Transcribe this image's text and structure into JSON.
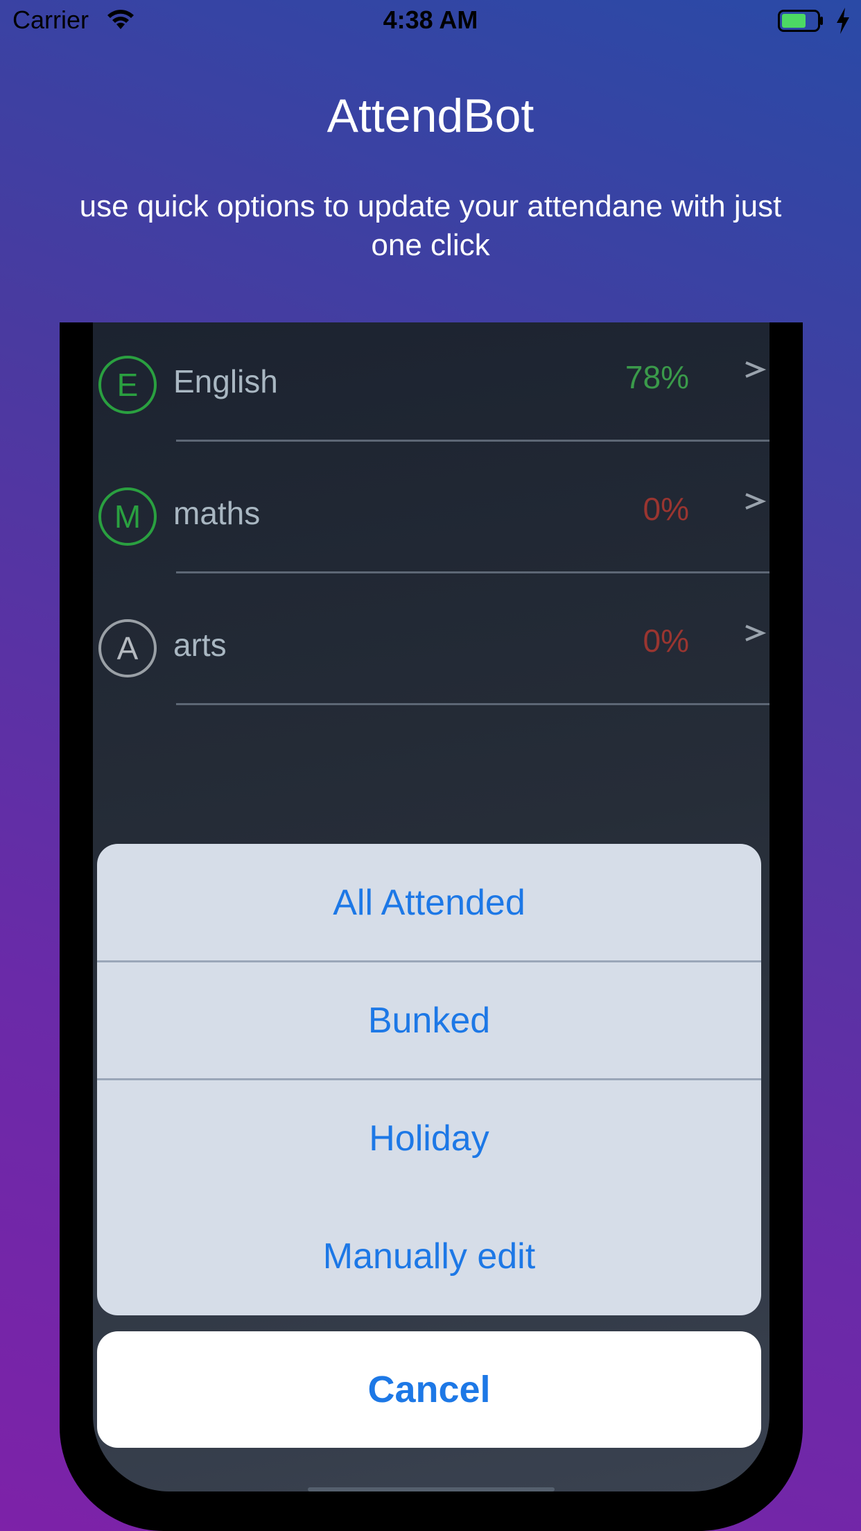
{
  "status_bar": {
    "carrier": "Carrier",
    "time": "4:38 AM",
    "battery_color": "#4cd964"
  },
  "header": {
    "title": "AttendBot",
    "subtitle": "use quick options to update your attendane with just one click"
  },
  "subjects": [
    {
      "initial": "E",
      "name": "English",
      "percent": "78%",
      "status": "green"
    },
    {
      "initial": "M",
      "name": "maths",
      "percent": "0%",
      "status": "red"
    },
    {
      "initial": "A",
      "name": "arts",
      "percent": "0%",
      "status": "red"
    }
  ],
  "action_sheet": {
    "options": [
      "All Attended",
      "Bunked",
      "Holiday",
      "Manually edit"
    ],
    "cancel": "Cancel"
  },
  "colors": {
    "accent": "#1d78e6",
    "green": "#2aa040",
    "red": "#9a3530"
  }
}
